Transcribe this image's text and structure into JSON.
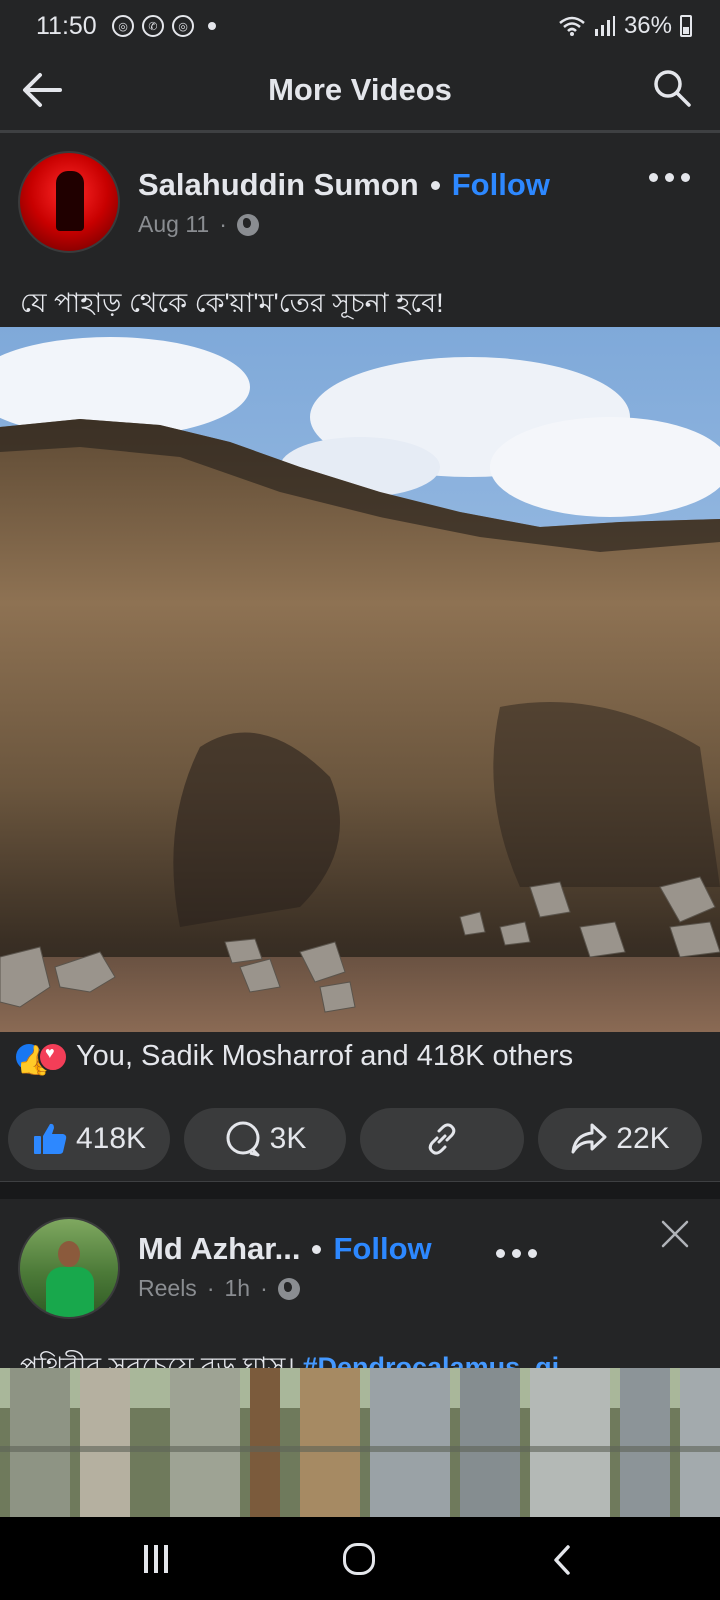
{
  "status_bar": {
    "time": "11:50",
    "battery": "36%",
    "icons": [
      "chrome-icon",
      "whatsapp-icon",
      "chrome-icon",
      "notification-dot",
      "wifi-icon",
      "signal-icon",
      "battery-icon"
    ]
  },
  "header": {
    "title": "More Videos",
    "back_icon": "arrow-left-icon",
    "search_icon": "search-icon"
  },
  "post1": {
    "author": "Salahuddin Sumon",
    "follow_label": "Follow",
    "date": "Aug 11",
    "caption": "যে পাহাড় থেকে কে'য়া'ম'তের সূচনা হবে!",
    "reactions_text": "You, Sadik Mosharrof and 418K others",
    "like_count": "418K",
    "comment_count": "3K",
    "share_count": "22K"
  },
  "post2": {
    "author": "Md Azhar...",
    "follow_label": "Follow",
    "source": "Reels",
    "time": "1h",
    "caption_text": "পৃথিবীর সবচেয়ে বড় ঘাস।",
    "hashtag": "#Dendrocalamus_gi",
    "ellipsis": "..."
  },
  "colors": {
    "background": "#242526",
    "accent": "#2d88ff",
    "hashtag": "#4599ff",
    "secondary_text": "#8a8d91",
    "pill": "#3a3b3c"
  }
}
